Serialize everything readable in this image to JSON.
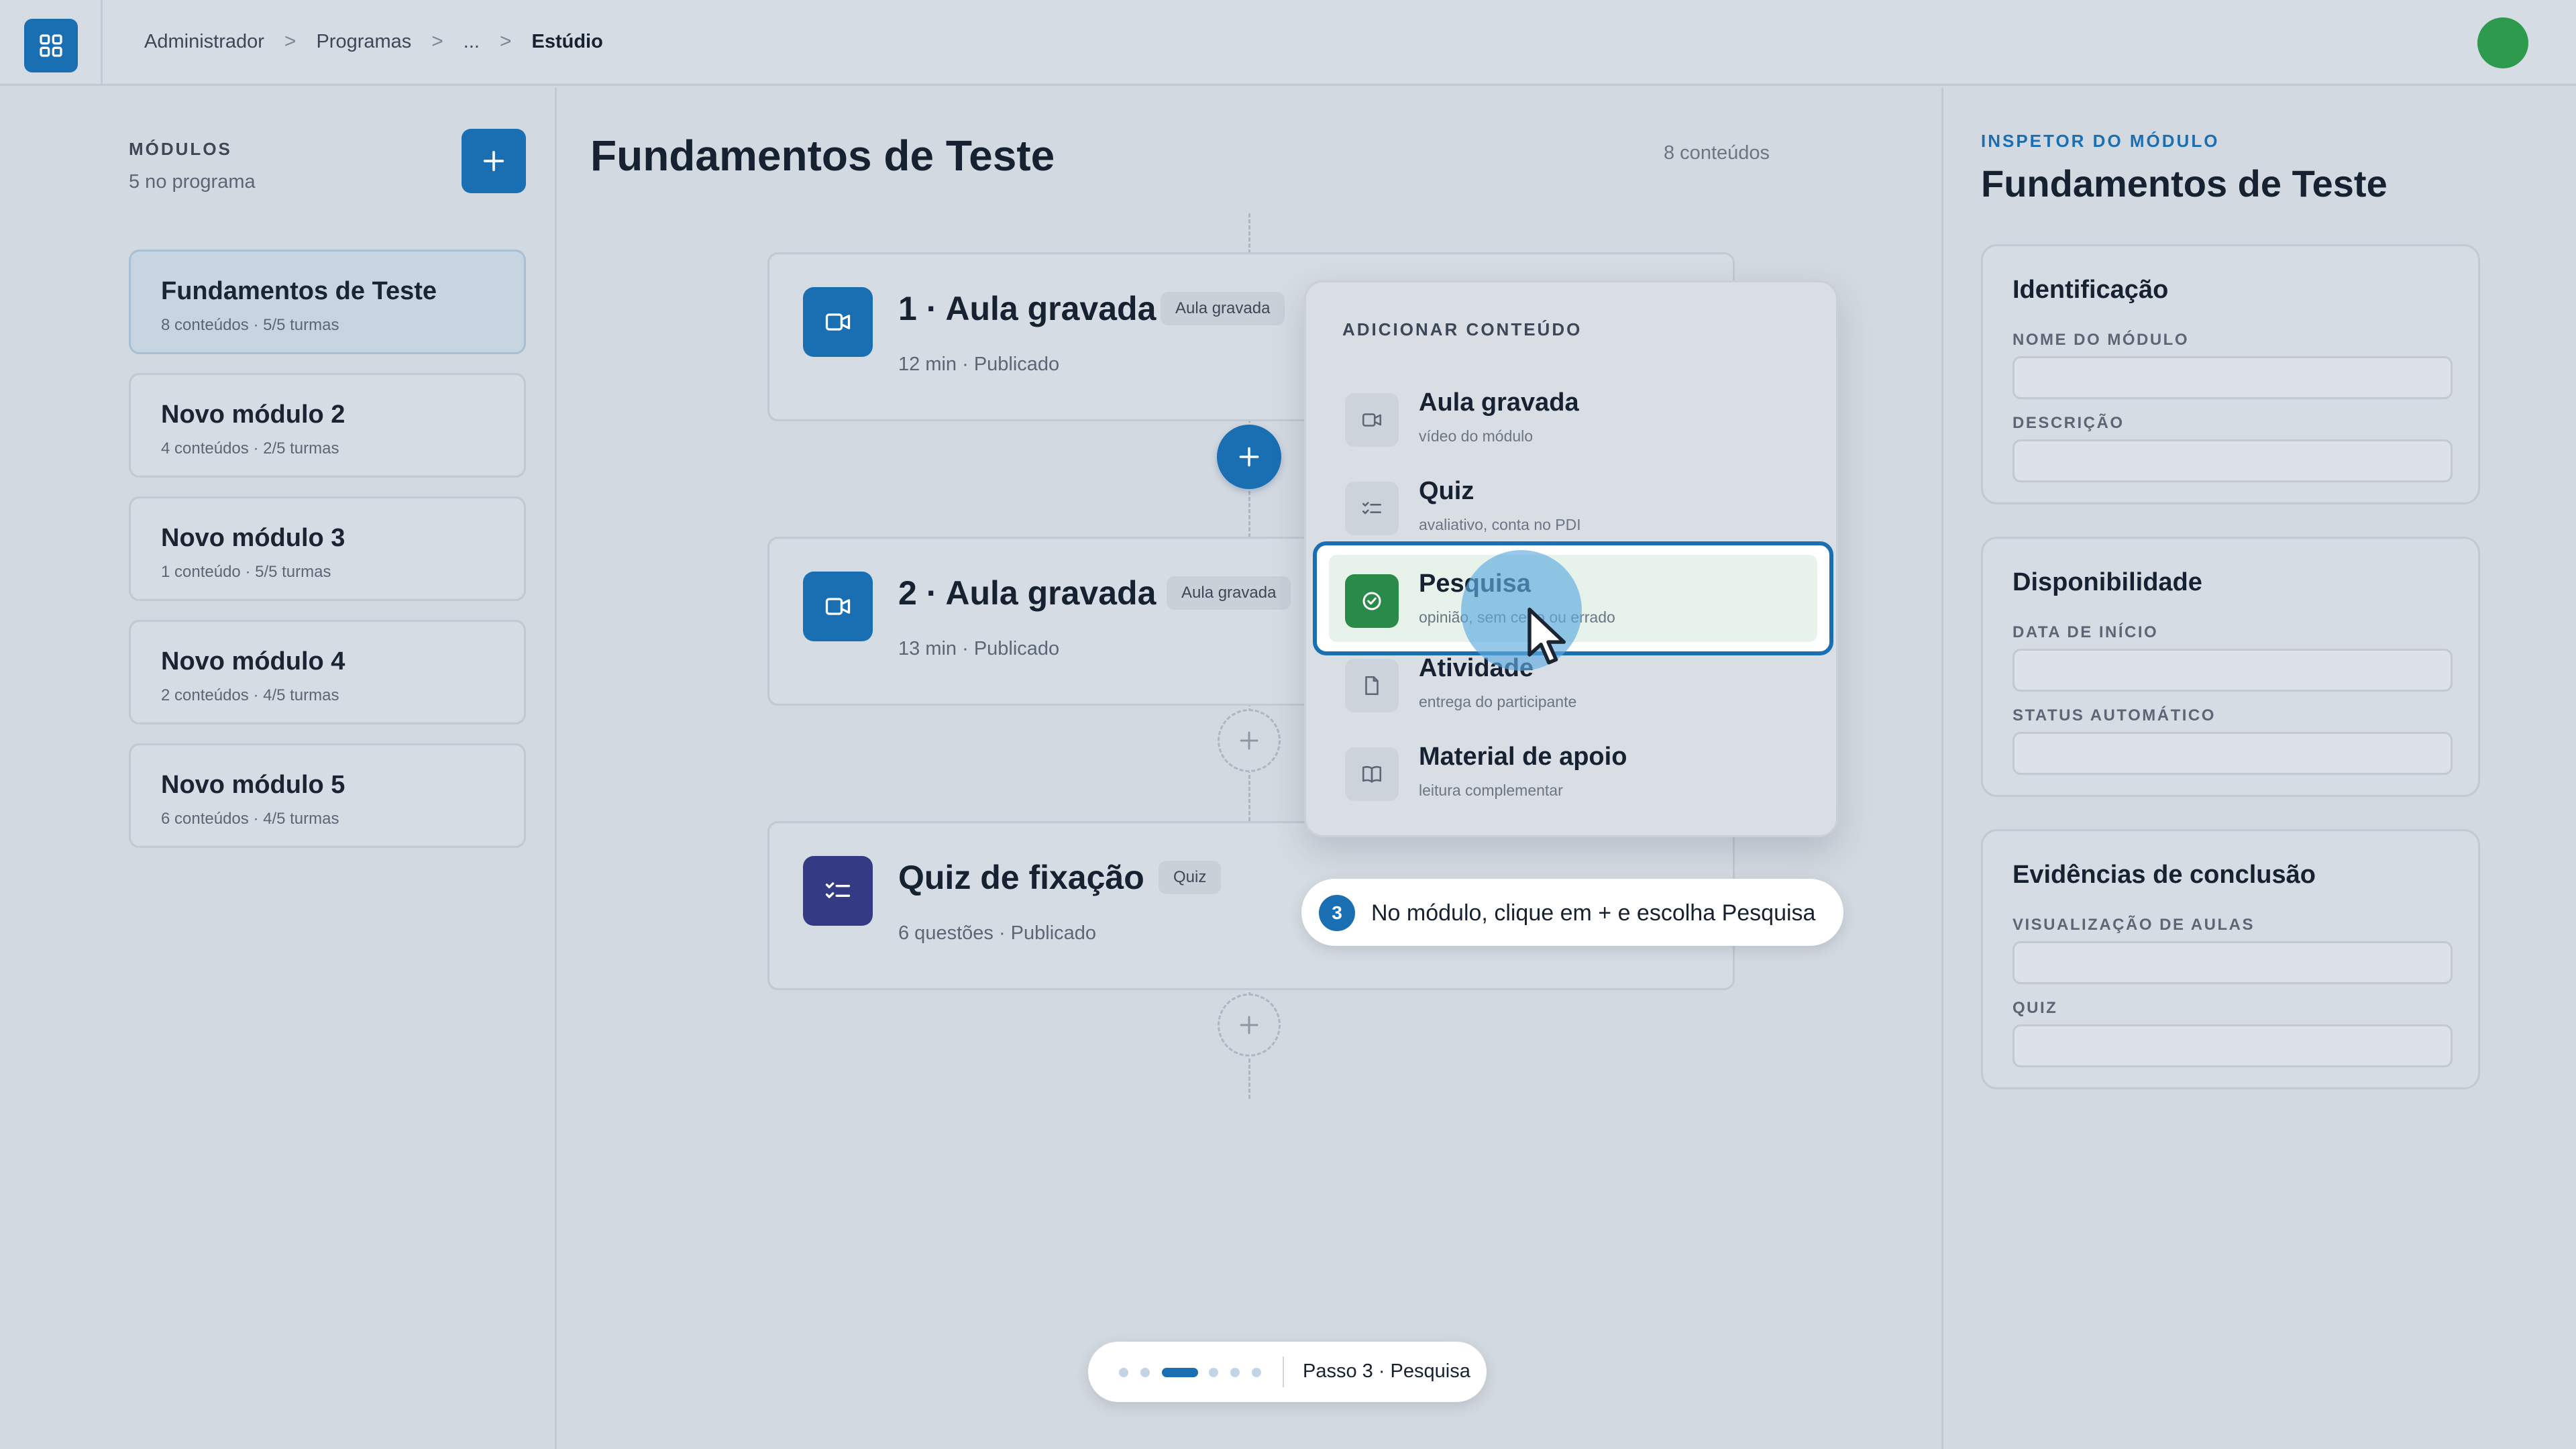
{
  "topbar": {
    "breadcrumb": [
      "Administrador",
      "Programas",
      "...",
      "Estúdio"
    ],
    "separator": ">",
    "avatar_color": "#2d9a4e"
  },
  "modules": {
    "title": "MÓDULOS",
    "subtitle": "5 no programa",
    "add_label": "+",
    "items": [
      {
        "name": "Fundamentos de Teste",
        "meta": "8 conteúdos · 5/5 turmas",
        "active": true
      },
      {
        "name": "Novo módulo 2",
        "meta": "4 conteúdos · 2/5 turmas"
      },
      {
        "name": "Novo módulo 3",
        "meta": "1 conteúdo · 5/5 turmas"
      },
      {
        "name": "Novo módulo 4",
        "meta": "2 conteúdos · 4/5 turmas"
      },
      {
        "name": "Novo módulo 5",
        "meta": "6 conteúdos · 4/5 turmas"
      }
    ]
  },
  "main": {
    "title": "Fundamentos de Teste",
    "count": "8 conteúdos",
    "cards": [
      {
        "title": "1 · Aula gravada",
        "badge": "Aula gravada",
        "meta": "12 min · Publicado",
        "icon": "video-icon",
        "color": "#1a6fb3"
      },
      {
        "title": "2 · Aula gravada",
        "badge": "Aula gravada",
        "meta": "13 min · Publicado",
        "icon": "video-icon",
        "color": "#1a6fb3"
      },
      {
        "title": "Quiz de fixação",
        "badge": "Quiz",
        "meta": "6 questões · Publicado",
        "icon": "checklist-icon",
        "color": "#343b84"
      }
    ]
  },
  "dropdown": {
    "title": "ADICIONAR CONTEÚDO",
    "items": [
      {
        "label": "Aula gravada",
        "sub": "vídeo do módulo",
        "icon": "video-icon"
      },
      {
        "label": "Quiz",
        "sub": "avaliativo, conta no PDI",
        "icon": "checklist-icon"
      },
      {
        "label": "Pesquisa",
        "sub": "opinião, sem certo ou errado",
        "icon": "check-circle-icon",
        "highlighted": true
      },
      {
        "label": "Atividade",
        "sub": "entrega do participante",
        "icon": "document-icon"
      },
      {
        "label": "Material de apoio",
        "sub": "leitura complementar",
        "icon": "book-icon"
      }
    ]
  },
  "tooltip": {
    "step": "3",
    "text": "No módulo, clique em + e escolha Pesquisa"
  },
  "stepper": {
    "total_steps": 6,
    "current_step": 3,
    "label": "Passo 3 · Pesquisa"
  },
  "inspector": {
    "title": "INSPETOR DO MÓDULO",
    "name": "Fundamentos de Teste",
    "sections": [
      {
        "title": "Identificação",
        "fields": [
          {
            "label": "NOME DO MÓDULO",
            "value": ""
          },
          {
            "label": "DESCRIÇÃO",
            "value": ""
          }
        ]
      },
      {
        "title": "Disponibilidade",
        "fields": [
          {
            "label": "DATA DE INÍCIO",
            "value": ""
          },
          {
            "label": "STATUS AUTOMÁTICO",
            "value": ""
          }
        ]
      },
      {
        "title": "Evidências de conclusão",
        "fields": [
          {
            "label": "VISUALIZAÇÃO DE AULAS",
            "value": ""
          },
          {
            "label": "QUIZ",
            "value": ""
          }
        ]
      }
    ]
  },
  "colors": {
    "accent": "#1a6fb3",
    "success": "#2a8a49",
    "quiz": "#343b84"
  }
}
